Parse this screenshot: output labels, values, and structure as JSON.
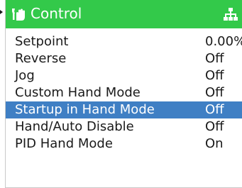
{
  "header": {
    "title": "Control",
    "left_icon": "hand-wrench-icon",
    "right_icon": "network-icon",
    "bar_color": "#33c94a"
  },
  "menu": {
    "selected_color": "#3f7fc4",
    "selected_index": 4,
    "items": [
      {
        "label": "Setpoint",
        "value": "0.00%"
      },
      {
        "label": "Reverse",
        "value": "Off"
      },
      {
        "label": "Jog",
        "value": "Off"
      },
      {
        "label": "Custom Hand Mode",
        "value": "Off"
      },
      {
        "label": "Startup in Hand Mode",
        "value": "Off"
      },
      {
        "label": "Hand/Auto Disable",
        "value": "Off"
      },
      {
        "label": "PID Hand Mode",
        "value": "On"
      }
    ]
  }
}
